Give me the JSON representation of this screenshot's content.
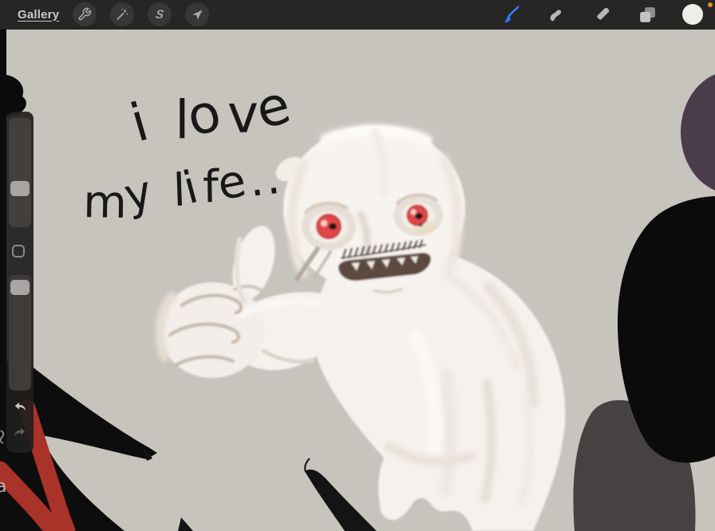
{
  "topbar": {
    "gallery_label": "Gallery",
    "left_tools": [
      {
        "id": "actions",
        "icon": "wrench-icon"
      },
      {
        "id": "adjustments",
        "icon": "magic-wand-icon"
      },
      {
        "id": "selection",
        "icon": "selection-s-icon",
        "glyph": "S"
      },
      {
        "id": "transform",
        "icon": "transform-arrow-icon"
      }
    ],
    "right_tools": [
      {
        "id": "paint",
        "icon": "paintbrush-icon",
        "selected": true
      },
      {
        "id": "smudge",
        "icon": "smudge-finger-icon",
        "selected": false
      },
      {
        "id": "erase",
        "icon": "eraser-icon",
        "selected": false
      },
      {
        "id": "layers",
        "icon": "layers-icon",
        "selected": false
      },
      {
        "id": "color",
        "icon": "color-swatch-icon",
        "selected": false
      }
    ],
    "accent_color": "#2f7df0",
    "current_color_swatch": "#efede9",
    "status_dot_color": "#e0912c"
  },
  "sidebar": {
    "brush_size_slider": {
      "name": "brush-size",
      "handle_pct": 58
    },
    "opacity_slider": {
      "name": "opacity",
      "handle_pct": 4
    },
    "modify_button_icon": "square-icon",
    "undo_icon": "undo-arrow-icon",
    "redo_icon": "redo-arrow-icon"
  },
  "canvas": {
    "background_color": "#c7c3bd",
    "handwritten_line1": "i love",
    "handwritten_line2": "my life..",
    "edge_letter": "a",
    "palette": {
      "ghost_white": "#f6f2ee",
      "eye_red": "#e04747",
      "mouth_brown": "#5c4840",
      "blob_purple": "#4a3c4b",
      "shape_black": "#0d0d0d",
      "dome_gray": "#454241",
      "stroke_red": "#a93229"
    }
  }
}
